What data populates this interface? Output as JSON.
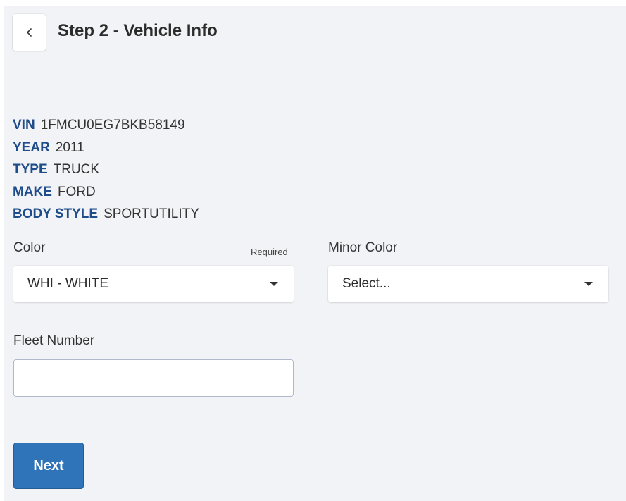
{
  "header": {
    "back_icon": "chevron-left-icon",
    "title": "Step 2 - Vehicle Info"
  },
  "vehicle": [
    {
      "label": "VIN",
      "value": "1FMCU0EG7BKB58149"
    },
    {
      "label": "YEAR",
      "value": "2011"
    },
    {
      "label": "TYPE",
      "value": "TRUCK"
    },
    {
      "label": "MAKE",
      "value": "FORD"
    },
    {
      "label": "BODY STYLE",
      "value": "SPORTUTILITY"
    }
  ],
  "form": {
    "color": {
      "label": "Color",
      "required_text": "Required",
      "value": "WHI - WHITE"
    },
    "minor_color": {
      "label": "Minor Color",
      "value": "Select..."
    },
    "fleet_number": {
      "label": "Fleet Number",
      "value": "",
      "placeholder": ""
    }
  },
  "actions": {
    "next_label": "Next"
  },
  "colors": {
    "accent": "#2f73b8",
    "label_blue": "#1f4c8a",
    "panel_bg": "#f2f3f6"
  }
}
